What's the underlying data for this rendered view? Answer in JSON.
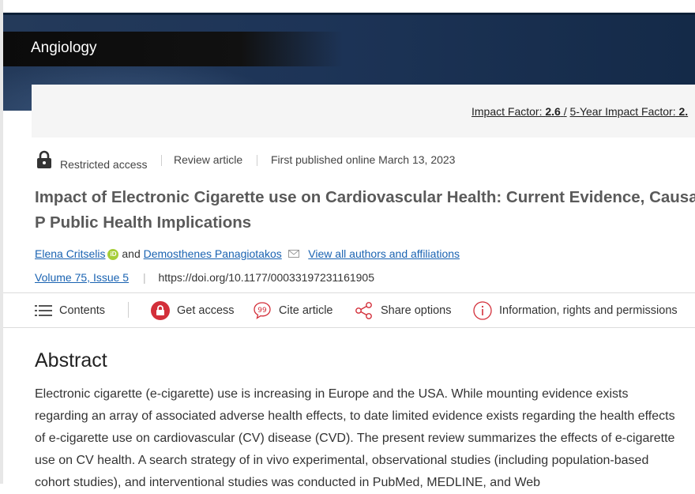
{
  "journal": {
    "name": "Angiology"
  },
  "metrics": {
    "impact_label": "Impact Factor:",
    "impact_value": "2.6",
    "separator": "/",
    "five_year_label": "5-Year Impact Factor:",
    "five_year_value": "2."
  },
  "article_meta": {
    "access": "Restricted access",
    "type": "Review article",
    "published": "First published online March 13, 2023"
  },
  "article": {
    "title": "Impact of Electronic Cigarette use on Cardiovascular Health: Current Evidence, Causal P Public Health Implications",
    "author1": "Elena Critselis",
    "orcid_label": "iD",
    "and": "and",
    "author2": "Demosthenes Panagiotakos",
    "view_all": "View all authors and affiliations",
    "volume": "Volume 75, Issue 5",
    "doi": "https://doi.org/10.1177/00033197231161905"
  },
  "toolbar": {
    "contents": "Contents",
    "get_access": "Get access",
    "cite": "Cite article",
    "share": "Share options",
    "info": "Information, rights and permissions"
  },
  "abstract": {
    "heading": "Abstract",
    "text": "Electronic cigarette (e-cigarette) use is increasing in Europe and the USA. While mounting evidence exists regarding an array of associated adverse health effects, to date limited evidence exists regarding the health effects of e-cigarette use on cardiovascular (CV) disease (CVD). The present review summarizes the effects of e-cigarette use on CV health. A search strategy of in vivo experimental, observational studies (including population-based cohort studies), and interventional studies was conducted in PubMed, MEDLINE, and Web"
  },
  "colors": {
    "link": "#1a63b2",
    "accent_red": "#d32f3a",
    "banner": "#1d3457",
    "orcid": "#a6ce39"
  }
}
